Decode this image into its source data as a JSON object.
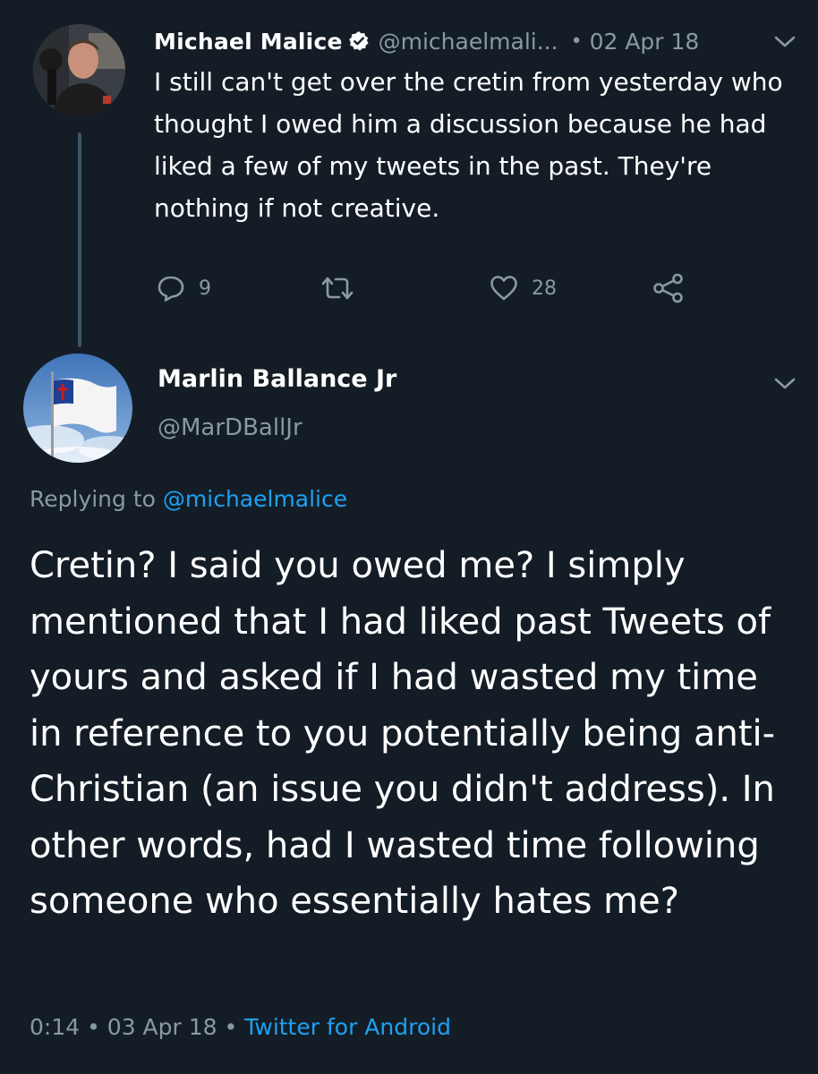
{
  "parent_tweet": {
    "author_name": "Michael Malice",
    "author_handle": "@michaelmali...",
    "separator": "•",
    "date": "02 Apr 18",
    "text": "I still can't get over the cretin from yesterday who thought I owed him a discussion because he had liked a few of my tweets in the past. They're nothing if not creative.",
    "actions": {
      "reply_count": "9",
      "like_count": "28"
    },
    "avatar_icon": "profile-photo",
    "verified_icon": "verified-badge-icon"
  },
  "reply_tweet": {
    "author_name": "Marlin Ballance Jr",
    "author_handle": "@MarDBallJr",
    "replying_prefix": "Replying to",
    "replying_to": "@michaelmalice",
    "text": "Cretin? I said you owed me? I simply mentioned that I had liked past Tweets of yours and asked if I had wasted my time in reference to you potentially being anti-Christian (an issue you didn't address). In other words, had I wasted time following someone who essentially hates me?",
    "time": "0:14",
    "separator": "•",
    "date": "03 Apr 18",
    "source": "Twitter for Android",
    "avatar_icon": "christian-flag-avatar"
  },
  "colors": {
    "background": "#141d26",
    "text_primary": "#ffffff",
    "text_secondary": "#8899a6",
    "accent": "#1da1f2",
    "thread_line": "#3d5466"
  }
}
